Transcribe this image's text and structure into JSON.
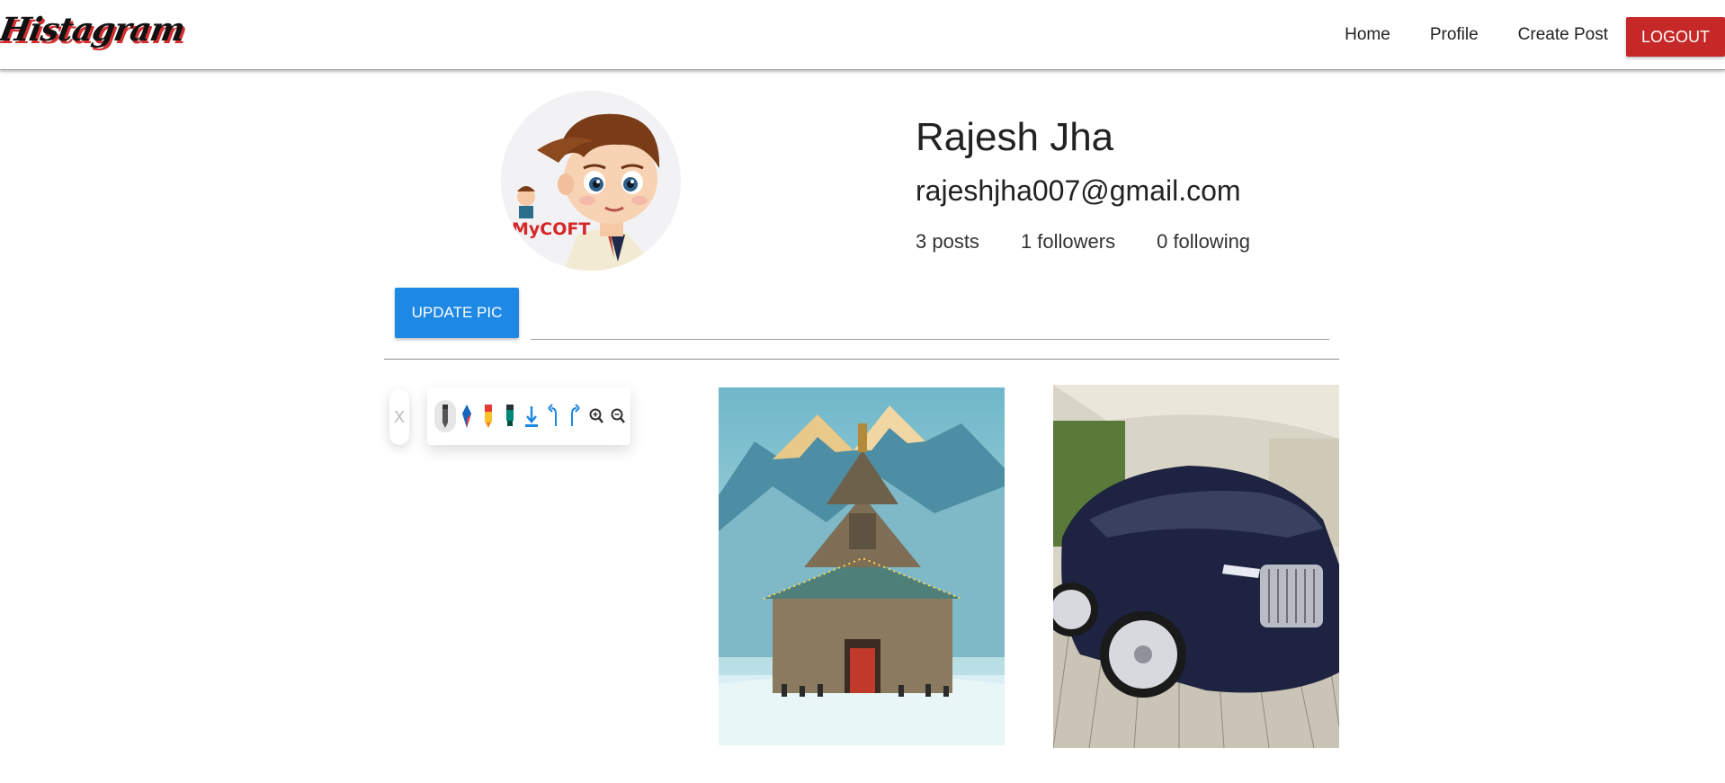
{
  "navbar": {
    "brand": "Histagram",
    "links": [
      {
        "label": "Home"
      },
      {
        "label": "Profile"
      },
      {
        "label": "Create Post"
      }
    ],
    "logout_label": "LOGOUT"
  },
  "profile": {
    "name": "Rajesh Jha",
    "email": "rajeshjha007@gmail.com",
    "avatar_text": "MyCOFT",
    "stats": {
      "posts": "3 posts",
      "followers": "1 followers",
      "following": "0 following"
    }
  },
  "update": {
    "button_label": "UPDATE PIC",
    "file_path_value": ""
  },
  "toolbar": {
    "close_label": "X",
    "tools": [
      "pen-icon",
      "eraser-icon",
      "marker-icon",
      "highlighter-icon",
      "download-icon",
      "undo-icon",
      "redo-icon",
      "zoom-in-icon",
      "zoom-out-icon"
    ]
  },
  "colors": {
    "logout": "#c62828",
    "update": "#1e88e5",
    "brand_shadow": "#d32f2f"
  }
}
